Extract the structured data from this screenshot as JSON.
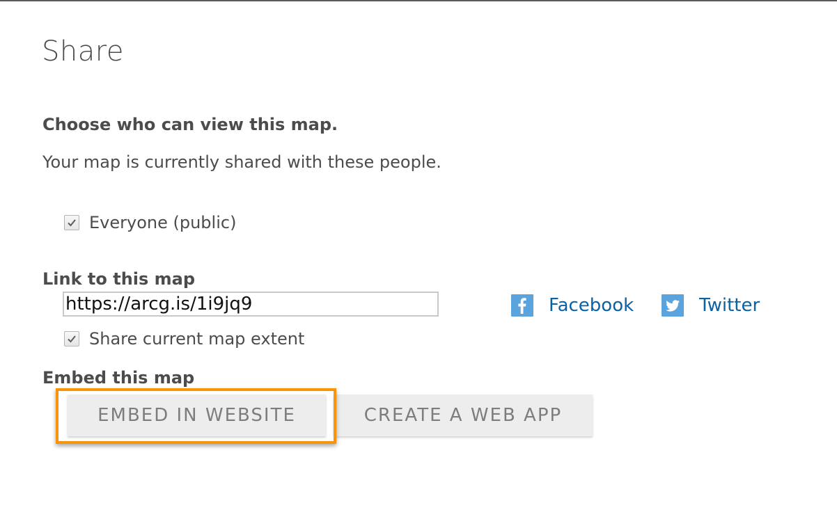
{
  "dialog": {
    "title": "Share"
  },
  "visibility": {
    "heading": "Choose who can view this map.",
    "description": "Your map is currently shared with these people.",
    "everyone_label": "Everyone (public)",
    "everyone_checked": true
  },
  "link": {
    "heading": "Link to this map",
    "url": "https://arcg.is/1i9jq9",
    "extent_label": "Share current map extent",
    "extent_checked": true
  },
  "social": {
    "facebook_label": "Facebook",
    "twitter_label": "Twitter",
    "icon_color": "#5ba3dc",
    "link_color": "#0a62a5"
  },
  "embed": {
    "heading": "Embed this map",
    "embed_button_label": "EMBED IN WEBSITE",
    "webapp_button_label": "CREATE A WEB APP",
    "highlight_color": "#f7940c"
  }
}
